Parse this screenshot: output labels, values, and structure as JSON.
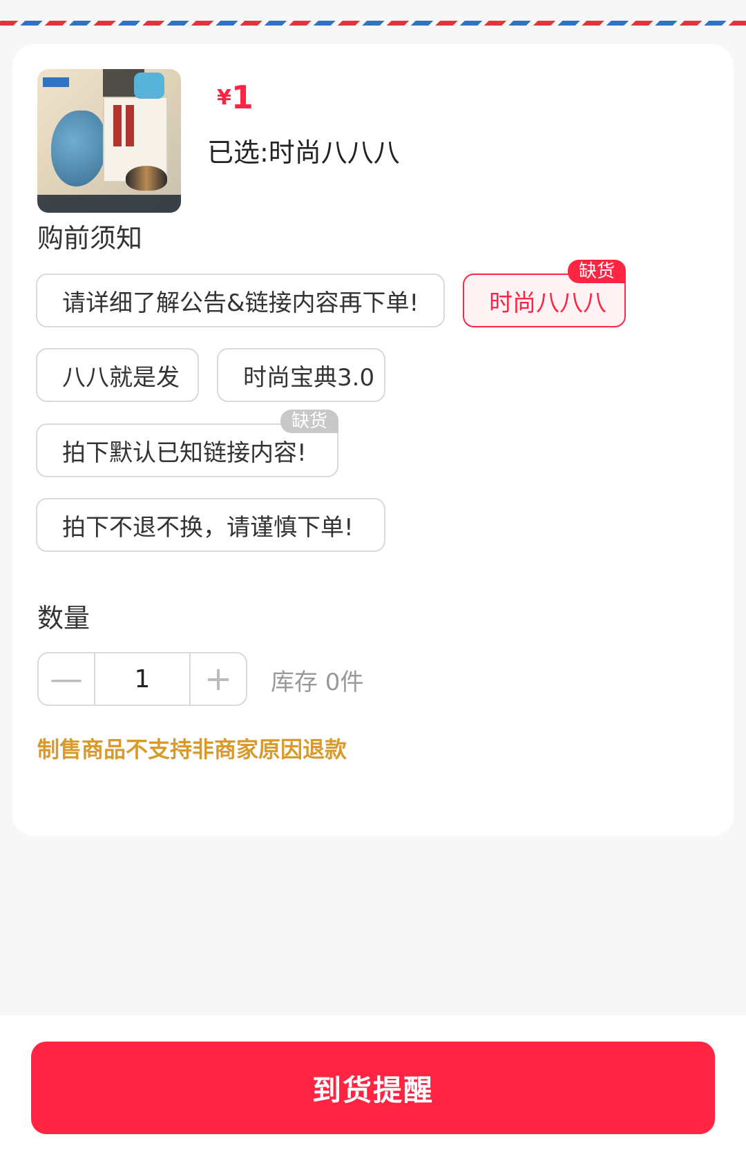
{
  "product": {
    "price_symbol": "¥",
    "price": "1",
    "selected_text": "已选:时尚八八八",
    "thumbnail": "magazine-cover-image"
  },
  "notice_section": {
    "title": "购前须知",
    "options": [
      {
        "label": "请详细了解公告&链接内容再下单!"
      },
      {
        "label": "时尚八八八",
        "badge": "缺货",
        "selected": true
      },
      {
        "label": "八八就是发"
      },
      {
        "label": "时尚宝典3.0"
      },
      {
        "label": "拍下默认已知链接内容!",
        "badge": "缺货"
      },
      {
        "label": "拍下不退不换，请谨慎下单!"
      }
    ]
  },
  "quantity": {
    "title": "数量",
    "minus": "—",
    "value": "1",
    "plus": "+",
    "stock": "库存 0件"
  },
  "policy_notice": "制售商品不支持非商家原因退款",
  "cta": {
    "label": "到货提醒"
  },
  "colors": {
    "accent": "#ff2442",
    "warning": "#d99a2b",
    "border": "#d9d9d9"
  }
}
